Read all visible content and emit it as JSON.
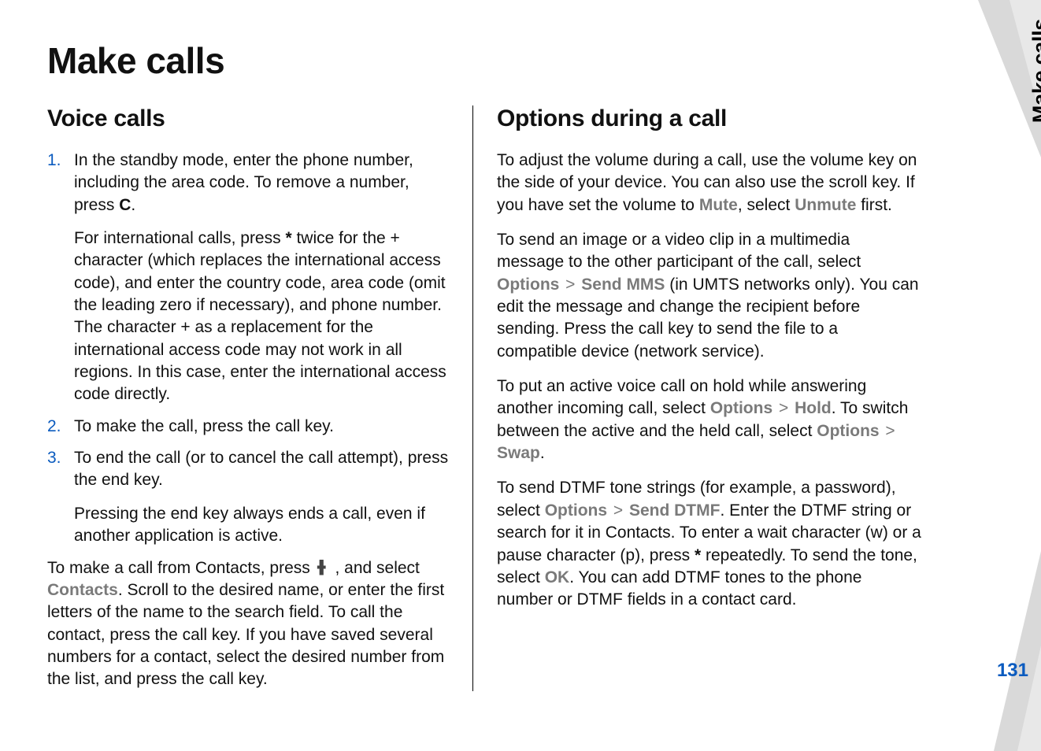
{
  "page": {
    "title": "Make calls",
    "side_tab": "Make calls",
    "page_number": "131"
  },
  "left": {
    "heading": "Voice calls",
    "items": [
      {
        "num": "1.",
        "lead": "In the standby mode, enter the phone number, including the area code. To remove a number, press ",
        "bold1": "C",
        "tail1": ".",
        "sub": "For international calls, press ",
        "bold2": "*",
        "sub2": " twice for the + character (which replaces the international access code), and enter the country code, area code (omit the leading zero if necessary), and phone number. The character + as a replacement for the international access code may not work in all regions. In this case, enter the international access code directly."
      },
      {
        "num": "2.",
        "lead": "To make the call, press the call key."
      },
      {
        "num": "3.",
        "lead": "To end the call (or to cancel the call attempt), press the end key.",
        "sub": "Pressing the end key always ends a call, even if another application is active."
      }
    ],
    "contacts_para": {
      "p1": "To make a call from Contacts, press ",
      "p2": " , and select ",
      "bold": "Contacts",
      "p3": ". Scroll to the desired name, or enter the first letters of the name to the search field. To call the contact, press the call key. If you have saved several numbers for a contact, select the desired number from the list, and press the call key."
    }
  },
  "right": {
    "heading": "Options during a call",
    "p1": {
      "a": "To adjust the volume during a call, use the volume key on the side of your device. You can also use the scroll key. If you have set the volume to ",
      "b": "Mute",
      "c": ", select ",
      "d": "Unmute",
      "e": " first."
    },
    "p2": {
      "a": "To send an image or a video clip in a multimedia message to the other participant of the call, select ",
      "b": "Options",
      "sep": " > ",
      "c": "Send MMS",
      "d": " (in UMTS networks only). You can edit the message and change the recipient before sending. Press the call key to send the file to a compatible device (network service)."
    },
    "p3": {
      "a": "To put an active voice call on hold while answering another incoming call, select ",
      "b": "Options",
      "sep1": " > ",
      "c": "Hold",
      "d": ". To switch between the active and the held call, select ",
      "e": "Options",
      "sep2": " > ",
      "f": "Swap",
      "g": "."
    },
    "p4": {
      "a": "To send DTMF tone strings (for example, a password), select ",
      "b": "Options",
      "sep": " > ",
      "c": "Send DTMF",
      "d": ". Enter the DTMF string or search for it in Contacts. To enter a wait character (w) or a pause character (p), press ",
      "e": "*",
      "f": " repeatedly. To send the tone, select ",
      "g": "OK",
      "h": ". You can add DTMF tones to the phone number or DTMF fields in a contact card."
    }
  }
}
